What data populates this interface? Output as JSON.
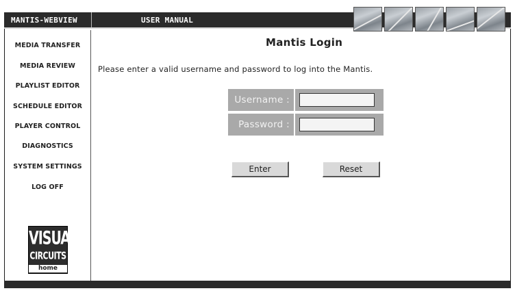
{
  "header": {
    "brand": "MANTIS-WEBVIEW",
    "manual_link": "USER MANUAL"
  },
  "sidebar": {
    "items": [
      {
        "label": "MEDIA TRANSFER"
      },
      {
        "label": "MEDIA REVIEW"
      },
      {
        "label": "PLAYLIST EDITOR"
      },
      {
        "label": "SCHEDULE EDITOR"
      },
      {
        "label": "PLAYER CONTROL"
      },
      {
        "label": "DIAGNOSTICS"
      },
      {
        "label": "SYSTEM SETTINGS"
      },
      {
        "label": "LOG OFF"
      }
    ],
    "logo": {
      "line1": "VISUAL",
      "line2": "CIRCUITS",
      "home_label": "home"
    }
  },
  "login": {
    "title": "Mantis Login",
    "instructions": "Please enter a valid username and password to log into the Mantis.",
    "username_label": "Username :",
    "username_value": "",
    "password_label": "Password :",
    "password_value": "",
    "enter_label": "Enter",
    "reset_label": "Reset"
  },
  "colors": {
    "bar": "#2b2b2b",
    "form_cell": "#a9a9a9",
    "button_face": "#d9d9d9"
  }
}
